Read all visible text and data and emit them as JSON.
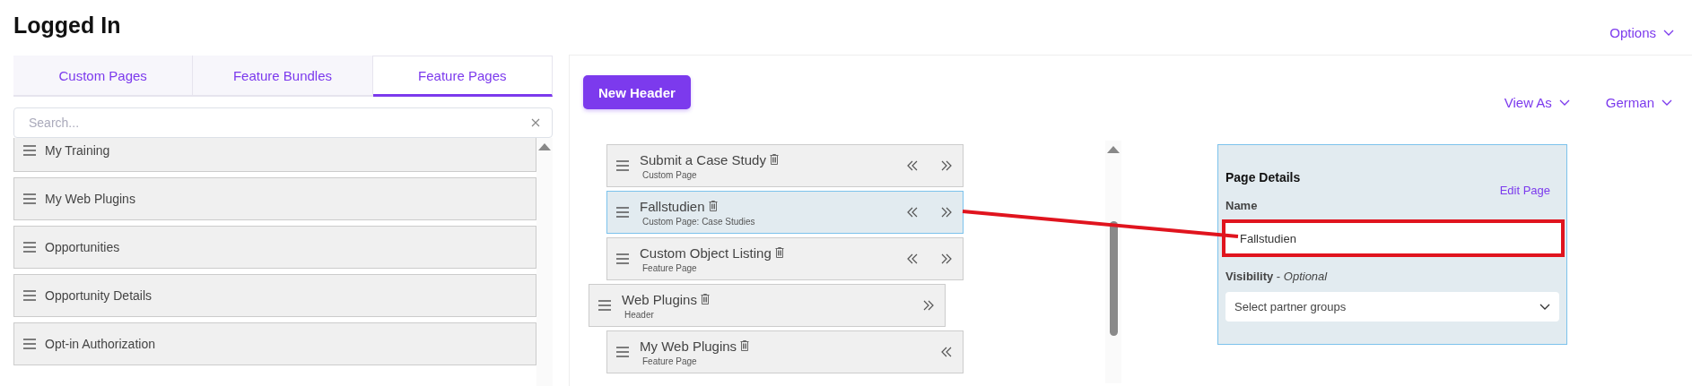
{
  "page_title": "Logged In",
  "options_menu": {
    "label": "Options"
  },
  "tabs": [
    {
      "label": "Custom Pages",
      "selected": false
    },
    {
      "label": "Feature Bundles",
      "selected": false
    },
    {
      "label": "Feature Pages",
      "selected": true
    }
  ],
  "search": {
    "placeholder": "Search..."
  },
  "feature_pages": [
    {
      "label": "My Training"
    },
    {
      "label": "My Web Plugins"
    },
    {
      "label": "Opportunities"
    },
    {
      "label": "Opportunity Details"
    },
    {
      "label": "Opt-in Authorization"
    }
  ],
  "new_header_button": "New Header",
  "view_as_menu": {
    "label": "View As"
  },
  "language_menu": {
    "label": "German"
  },
  "navigation_tree": [
    {
      "children": [
        {
          "title": "Submit a Case Study",
          "subtitle": "Custom Page",
          "selected": false,
          "move_left": true,
          "move_right": true
        },
        {
          "title": "Fallstudien",
          "subtitle": "Custom Page: Case Studies",
          "selected": true,
          "move_left": true,
          "move_right": true
        },
        {
          "title": "Custom Object Listing",
          "subtitle": "Feature Page",
          "selected": false,
          "move_left": true,
          "move_right": true
        }
      ]
    },
    {
      "title": "Web Plugins",
      "subtitle": "Header",
      "selected": false,
      "move_left": false,
      "move_right": true,
      "children": [
        {
          "title": "My Web Plugins",
          "subtitle": "Feature Page",
          "selected": false,
          "move_left": true,
          "move_right": false
        }
      ]
    }
  ],
  "page_details": {
    "title": "Page Details",
    "edit_link": "Edit Page",
    "name_label": "Name",
    "name_value": "Fallstudien",
    "name_highlighted": true,
    "visibility_label": "**Visibility** - *Optional*",
    "visibility_placeholder": "Select partner groups"
  }
}
